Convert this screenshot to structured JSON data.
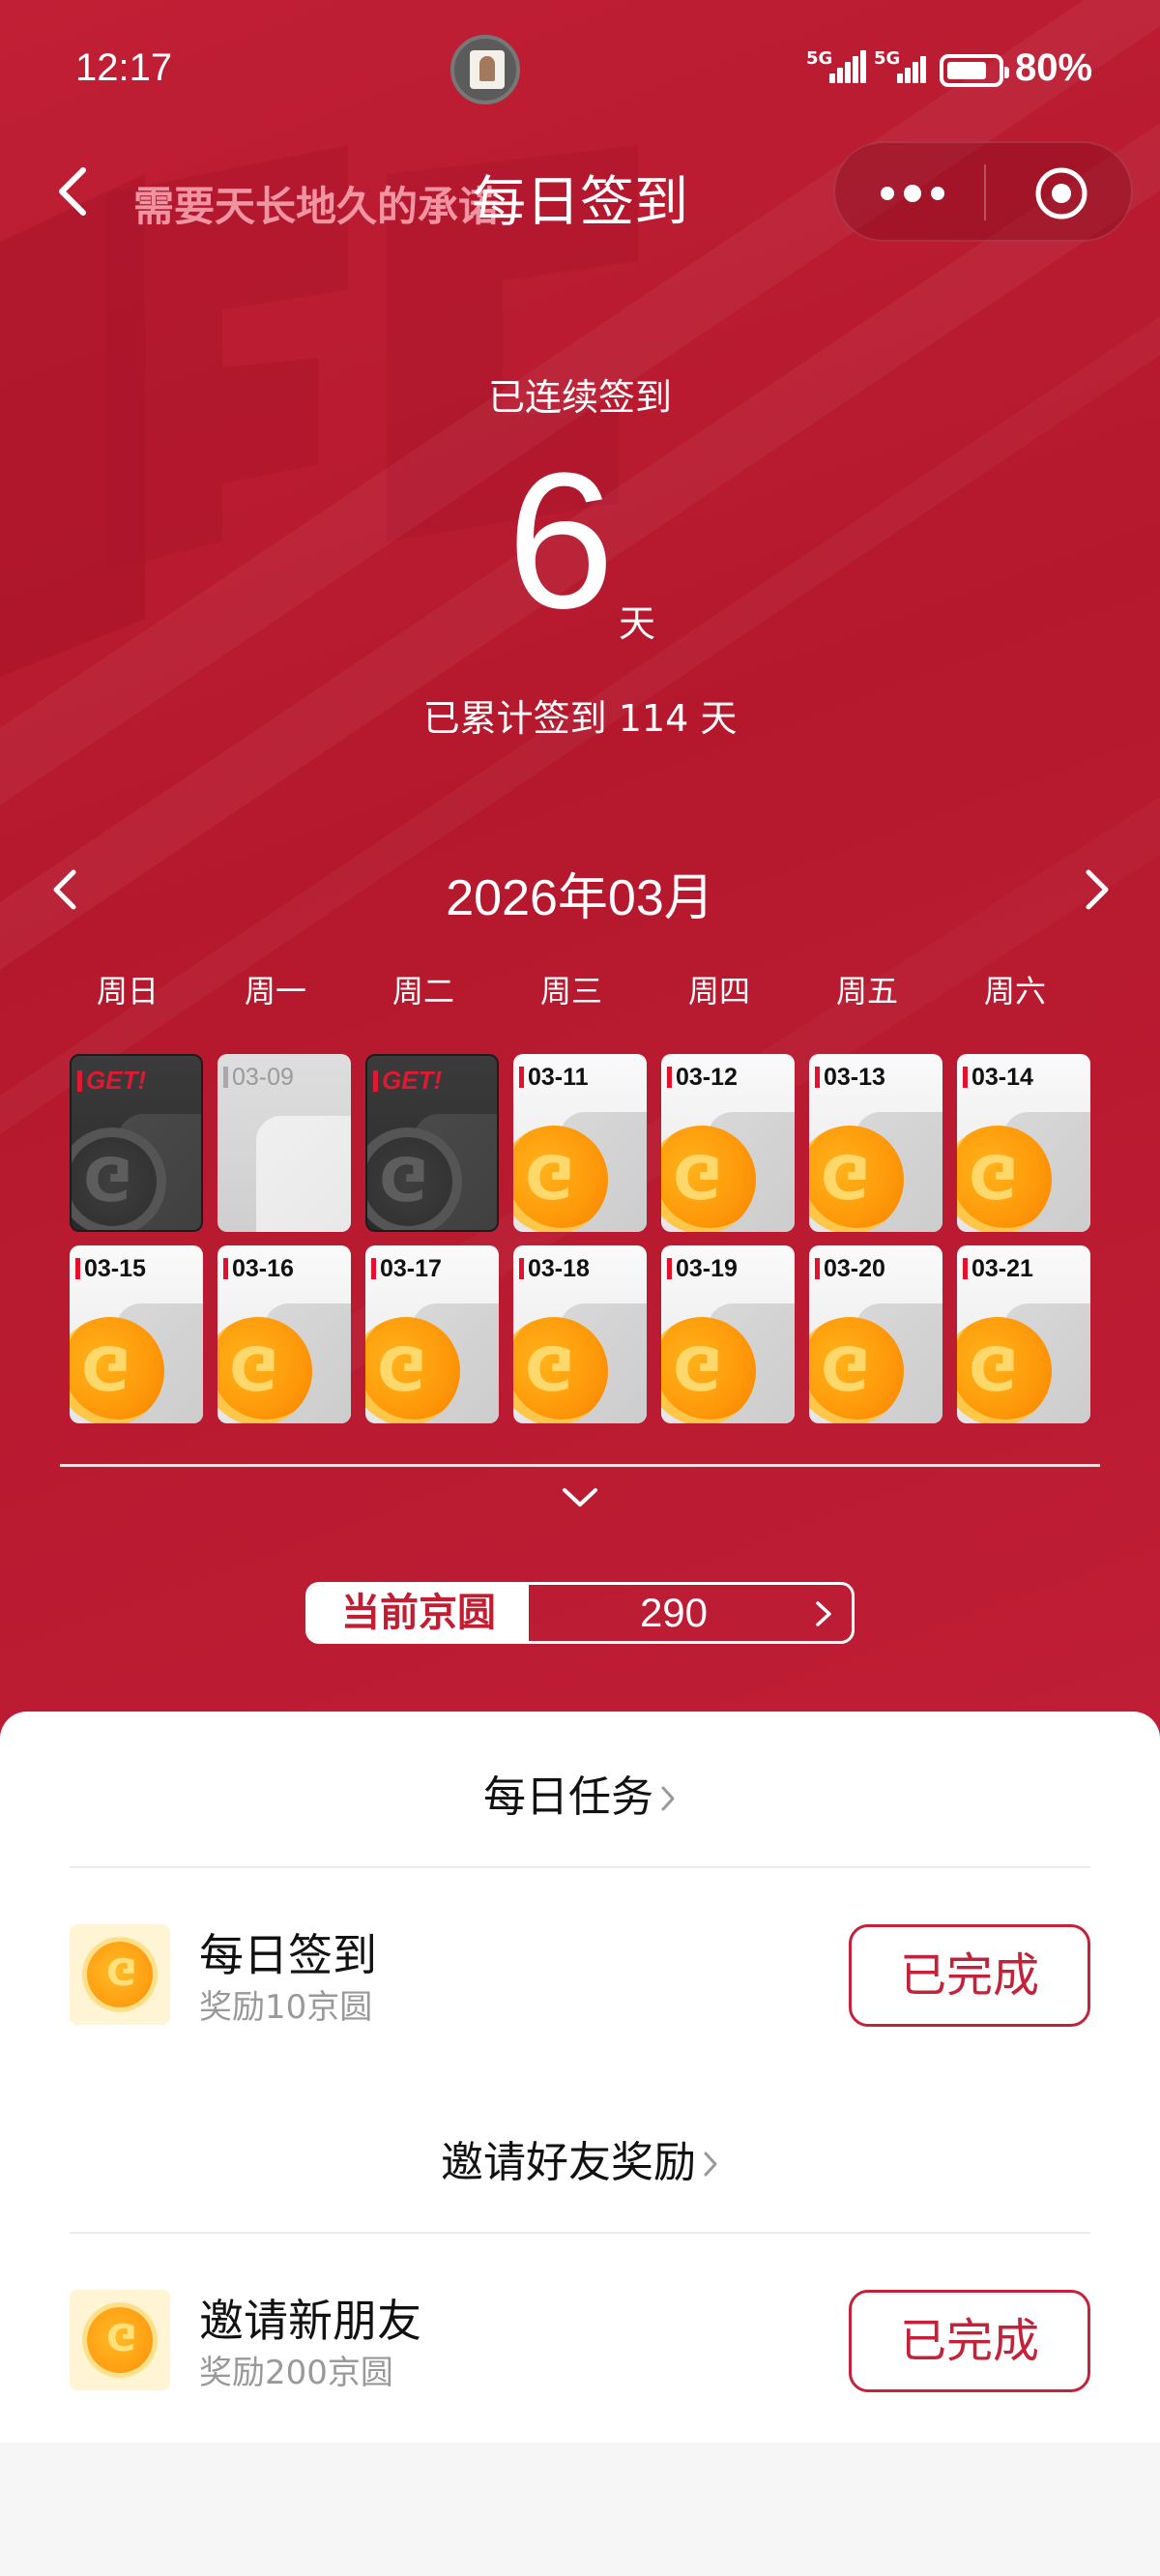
{
  "status_bar": {
    "time": "12:17",
    "signal_1": "5G",
    "signal_2": "5G",
    "battery": "80%"
  },
  "nav": {
    "marquee": "需要天长地久的承诺",
    "title": "每日签到"
  },
  "streak": {
    "label": "已连续签到",
    "days": "6",
    "unit": "天",
    "total": "已累计签到 114 天"
  },
  "calendar": {
    "month": "2026年03月",
    "weekdays": [
      "周日",
      "周一",
      "周二",
      "周三",
      "周四",
      "周五",
      "周六"
    ],
    "rows": [
      [
        {
          "label": "GET!",
          "state": "got"
        },
        {
          "label": "03-09",
          "state": "missed"
        },
        {
          "label": "GET!",
          "state": "got"
        },
        {
          "label": "03-11",
          "state": "reward"
        },
        {
          "label": "03-12",
          "state": "reward"
        },
        {
          "label": "03-13",
          "state": "reward"
        },
        {
          "label": "03-14",
          "state": "reward"
        }
      ],
      [
        {
          "label": "03-15",
          "state": "reward"
        },
        {
          "label": "03-16",
          "state": "reward"
        },
        {
          "label": "03-17",
          "state": "reward"
        },
        {
          "label": "03-18",
          "state": "reward"
        },
        {
          "label": "03-19",
          "state": "reward"
        },
        {
          "label": "03-20",
          "state": "reward"
        },
        {
          "label": "03-21",
          "state": "reward"
        }
      ]
    ]
  },
  "jd_coins": {
    "label": "当前京圆",
    "value": "290"
  },
  "daily_tasks": {
    "title": "每日任务",
    "items": [
      {
        "title": "每日签到",
        "reward": "奖励10京圆",
        "status": "已完成"
      }
    ]
  },
  "invite": {
    "title": "邀请好友奖励",
    "items": [
      {
        "title": "邀请新朋友",
        "reward": "奖励200京圆",
        "status": "已完成"
      }
    ]
  },
  "colors": {
    "brand_red": "#c01f35",
    "button_red": "#c2233a",
    "coin_orange": "#ff9a0a"
  }
}
